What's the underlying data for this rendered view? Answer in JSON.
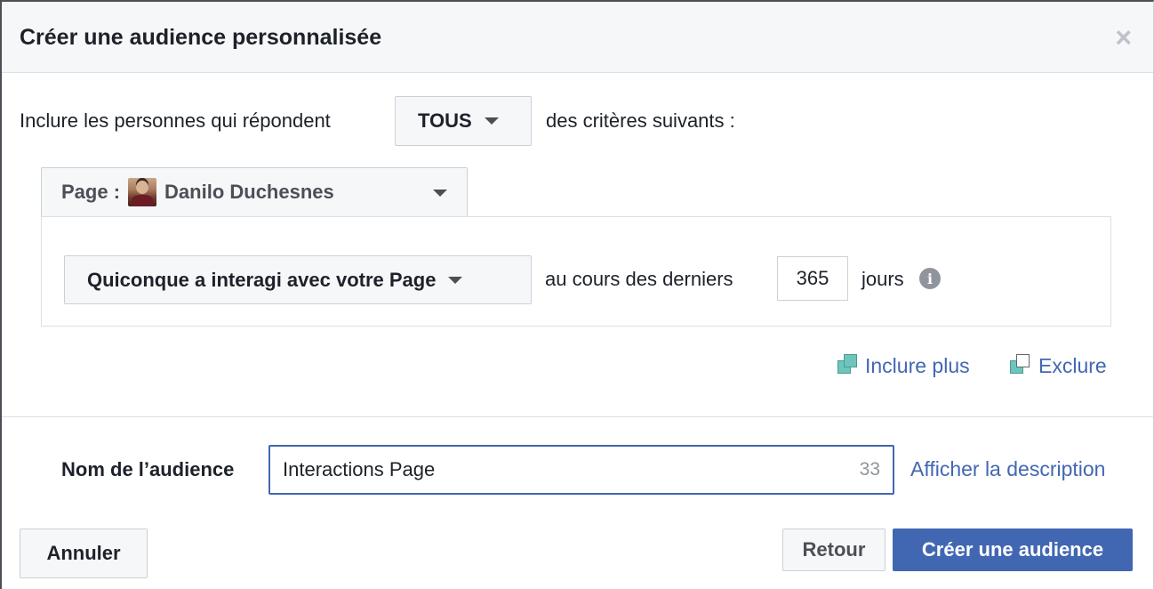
{
  "dialog": {
    "title": "Créer une audience personnalisée",
    "close_symbol": "×"
  },
  "criteria": {
    "prefix": "Inclure les personnes qui répondent",
    "match_value": "TOUS",
    "suffix": "des critères suivants :"
  },
  "source": {
    "label": "Page :",
    "page_name": "Danilo Duchesnes"
  },
  "rule": {
    "event": "Quiconque a interagi avec votre Page",
    "period_prefix": "au cours des derniers",
    "days": "365",
    "period_suffix": "jours",
    "info_symbol": "i"
  },
  "actions": {
    "include_more": "Inclure plus",
    "exclude": "Exclure"
  },
  "audience_name": {
    "label": "Nom de l’audience",
    "value": "Interactions Page",
    "remaining_chars": "33",
    "show_description": "Afficher la description"
  },
  "footer": {
    "cancel": "Annuler",
    "back": "Retour",
    "create": "Créer une audience"
  },
  "colors": {
    "primary": "#4267b2",
    "link": "#4267b2",
    "icon_teal": "#6cc6bb"
  },
  "icons": {
    "close": "close-icon",
    "dropdown": "chevron-down-icon",
    "info": "info-icon",
    "include": "stacked-squares-icon",
    "exclude": "stacked-squares-outline-icon"
  }
}
